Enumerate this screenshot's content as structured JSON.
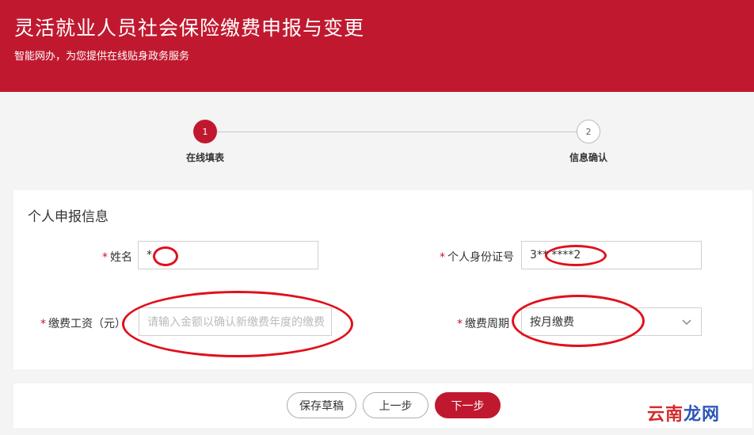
{
  "header": {
    "title": "灵活就业人员社会保险缴费申报与变更",
    "subtitle": "智能网办，为您提供在线贴身政务服务"
  },
  "steps": [
    {
      "number": "1",
      "label": "在线填表",
      "active": true
    },
    {
      "number": "2",
      "label": "信息确认",
      "active": false
    }
  ],
  "form": {
    "section_title": "个人申报信息",
    "required_mark": "*",
    "name_label": "姓名",
    "name_value": "*",
    "id_label": "个人身份证号",
    "id_value": "3**            ****2",
    "wage_label": "缴费工资（元）",
    "wage_placeholder": "请输入金额以确认新缴费年度的缴费",
    "period_label": "缴费周期",
    "period_value": "按月缴费"
  },
  "buttons": {
    "save_draft": "保存草稿",
    "prev": "上一步",
    "next": "下一步"
  },
  "watermark": {
    "text_a": "云南",
    "text_b": "龙网"
  },
  "colors": {
    "brand": "#c0192f",
    "annotation": "#e0101c"
  }
}
